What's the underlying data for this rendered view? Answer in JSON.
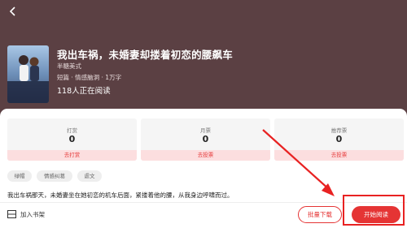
{
  "book": {
    "title": "我出车祸，未婚妻却搂着初恋的腰飙车",
    "author": "半糖美式",
    "meta": "短篇 · 情感脑洞 · 1万字",
    "reading_count": "118人正在阅读",
    "cover_text": "我出车祸，未婚妻却搂着初恋的腰飙车"
  },
  "stats": [
    {
      "label": "打赏",
      "value": "0",
      "action": "去打赏"
    },
    {
      "label": "月票",
      "value": "0",
      "action": "去投票"
    },
    {
      "label": "推荐票",
      "value": "0",
      "action": "去投票"
    }
  ],
  "tags": [
    "绿帽",
    "情感纠葛",
    "虐文"
  ],
  "synopsis": "我出车祸那天，未婚妻坐在她初恋的机车后面，紧搂着他的腰，从我身边呼啸而过。",
  "bottom_bar": {
    "bookshelf_label": "加入书架",
    "download_label": "批量下载",
    "read_label": "开始阅读"
  },
  "colors": {
    "header_bg": "#5b4043",
    "accent": "#e53434",
    "annotation_red": "#e82222"
  },
  "icons": {
    "back": "chevron-left-icon",
    "bookshelf": "bookshelf-icon"
  }
}
